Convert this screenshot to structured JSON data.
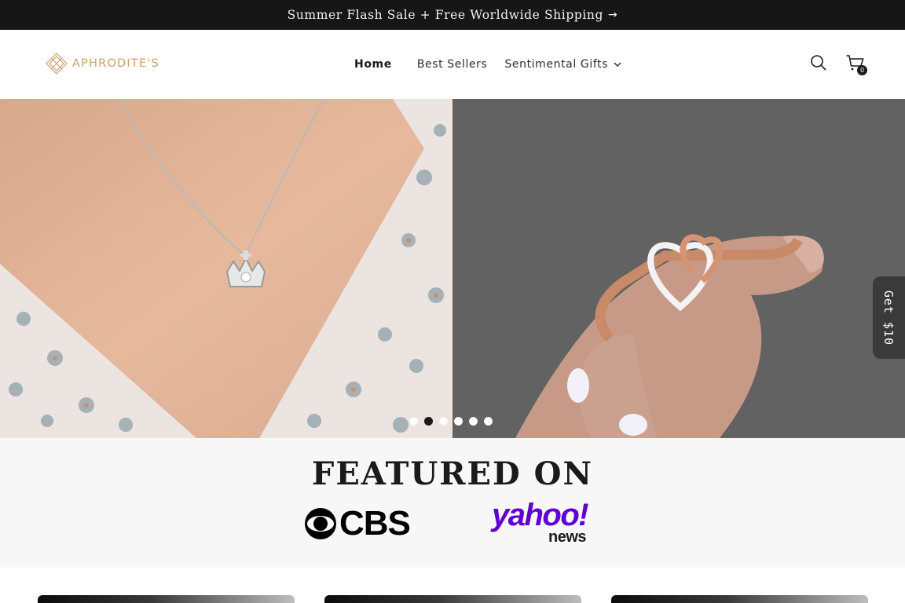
{
  "announcement": {
    "text": "Summer Flash Sale + Free Worldwide Shipping",
    "arrow_icon": "arrow-right-icon"
  },
  "header": {
    "logo_text": "APHRODITE'S",
    "nav": [
      {
        "label": "Home",
        "active": true
      },
      {
        "label": "Best Sellers",
        "active": false
      },
      {
        "label": "Sentimental Gifts",
        "active": false,
        "has_dropdown": true
      }
    ],
    "icons": [
      "search-icon",
      "cart-icon"
    ],
    "cart_count": "0"
  },
  "hero": {
    "slides": [
      {
        "subject": "crown-pendant-necklace"
      },
      {
        "subject": "heart-bangle-bracelet"
      }
    ],
    "dot_count": 6,
    "active_dot": 1
  },
  "side_tab": {
    "label": "Get $10"
  },
  "featured": {
    "title": "FEATURED ON",
    "logos": [
      {
        "name": "CBS",
        "wordmark": "CBS"
      },
      {
        "name": "yahoo news",
        "wordmark": "yahoo!",
        "sub": "news"
      }
    ]
  },
  "colors": {
    "announcement_bg": "#161616",
    "logo_gold": "#c8a06a",
    "featured_bg": "#f7f7f7",
    "yahoo_purple": "#6001d2",
    "side_tab_bg": "#3a3a3a"
  }
}
